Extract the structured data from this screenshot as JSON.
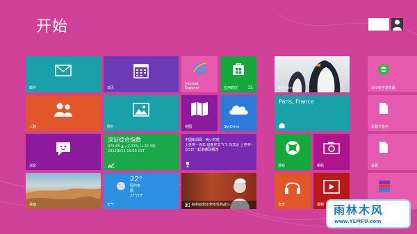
{
  "start": {
    "title": "开始"
  },
  "tiles": {
    "mail": {
      "label": "邮件"
    },
    "calendar": {
      "label": "日历"
    },
    "ie": {
      "label": "Internet Explorer"
    },
    "store": {
      "label": "应用商店",
      "count": "15"
    },
    "bing": {
      "label": "必应 Bing"
    },
    "people": {
      "label": "人脉"
    },
    "photos": {
      "label": "照片"
    },
    "maps": {
      "label": "地图"
    },
    "skydrive": {
      "label": "SkyDrive"
    },
    "travel": {
      "place": "Paris, France"
    },
    "finance": {
      "label": "深证综合指数",
      "value": "975.65 ▲ +2.13% (+20.39)",
      "time": "2012/6/14 15:00 CST"
    },
    "news": {
      "source": "中国新闻网 · 两小时前",
      "headline": "上任将一周年·国金先文飞飞 马式迅 上任将一周年·国金先文飞飞",
      "headline2": "以5日一起道德政纲改"
    },
    "messaging": {
      "label": "消息"
    },
    "desktop": {
      "label": "桌面"
    },
    "weather": {
      "temp": "22°",
      "city": "纽约市",
      "cond": "晴",
      "range": "27°/20°",
      "label": "天气"
    },
    "video_news": {
      "label": "叙利亚伯尔伊尔伦的战斗"
    },
    "xbox": {
      "label": "游戏"
    },
    "camera": {
      "label": "相机"
    },
    "music": {
      "label": "音乐"
    },
    "video": {
      "label": "视频"
    },
    "r1": {
      "label": "360安全浏览器"
    },
    "r2": {
      "label": "反联卡盒子"
    },
    "r3": {
      "label": "设置"
    },
    "r4": {
      "label": ""
    }
  },
  "watermark": {
    "title": "雨林木风",
    "url": "www.YLMFU.com"
  },
  "colors": {
    "background": "#d0419a",
    "accent_blue": "#1d78c8"
  }
}
